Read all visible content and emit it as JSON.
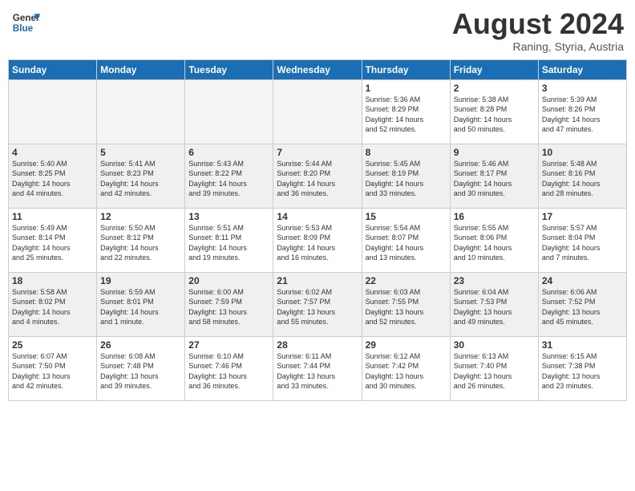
{
  "header": {
    "logo_line1": "General",
    "logo_line2": "Blue",
    "month": "August 2024",
    "location": "Raning, Styria, Austria"
  },
  "weekdays": [
    "Sunday",
    "Monday",
    "Tuesday",
    "Wednesday",
    "Thursday",
    "Friday",
    "Saturday"
  ],
  "weeks": [
    [
      {
        "day": "",
        "info": ""
      },
      {
        "day": "",
        "info": ""
      },
      {
        "day": "",
        "info": ""
      },
      {
        "day": "",
        "info": ""
      },
      {
        "day": "1",
        "info": "Sunrise: 5:36 AM\nSunset: 8:29 PM\nDaylight: 14 hours\nand 52 minutes."
      },
      {
        "day": "2",
        "info": "Sunrise: 5:38 AM\nSunset: 8:28 PM\nDaylight: 14 hours\nand 50 minutes."
      },
      {
        "day": "3",
        "info": "Sunrise: 5:39 AM\nSunset: 8:26 PM\nDaylight: 14 hours\nand 47 minutes."
      }
    ],
    [
      {
        "day": "4",
        "info": "Sunrise: 5:40 AM\nSunset: 8:25 PM\nDaylight: 14 hours\nand 44 minutes."
      },
      {
        "day": "5",
        "info": "Sunrise: 5:41 AM\nSunset: 8:23 PM\nDaylight: 14 hours\nand 42 minutes."
      },
      {
        "day": "6",
        "info": "Sunrise: 5:43 AM\nSunset: 8:22 PM\nDaylight: 14 hours\nand 39 minutes."
      },
      {
        "day": "7",
        "info": "Sunrise: 5:44 AM\nSunset: 8:20 PM\nDaylight: 14 hours\nand 36 minutes."
      },
      {
        "day": "8",
        "info": "Sunrise: 5:45 AM\nSunset: 8:19 PM\nDaylight: 14 hours\nand 33 minutes."
      },
      {
        "day": "9",
        "info": "Sunrise: 5:46 AM\nSunset: 8:17 PM\nDaylight: 14 hours\nand 30 minutes."
      },
      {
        "day": "10",
        "info": "Sunrise: 5:48 AM\nSunset: 8:16 PM\nDaylight: 14 hours\nand 28 minutes."
      }
    ],
    [
      {
        "day": "11",
        "info": "Sunrise: 5:49 AM\nSunset: 8:14 PM\nDaylight: 14 hours\nand 25 minutes."
      },
      {
        "day": "12",
        "info": "Sunrise: 5:50 AM\nSunset: 8:12 PM\nDaylight: 14 hours\nand 22 minutes."
      },
      {
        "day": "13",
        "info": "Sunrise: 5:51 AM\nSunset: 8:11 PM\nDaylight: 14 hours\nand 19 minutes."
      },
      {
        "day": "14",
        "info": "Sunrise: 5:53 AM\nSunset: 8:09 PM\nDaylight: 14 hours\nand 16 minutes."
      },
      {
        "day": "15",
        "info": "Sunrise: 5:54 AM\nSunset: 8:07 PM\nDaylight: 14 hours\nand 13 minutes."
      },
      {
        "day": "16",
        "info": "Sunrise: 5:55 AM\nSunset: 8:06 PM\nDaylight: 14 hours\nand 10 minutes."
      },
      {
        "day": "17",
        "info": "Sunrise: 5:57 AM\nSunset: 8:04 PM\nDaylight: 14 hours\nand 7 minutes."
      }
    ],
    [
      {
        "day": "18",
        "info": "Sunrise: 5:58 AM\nSunset: 8:02 PM\nDaylight: 14 hours\nand 4 minutes."
      },
      {
        "day": "19",
        "info": "Sunrise: 5:59 AM\nSunset: 8:01 PM\nDaylight: 14 hours\nand 1 minute."
      },
      {
        "day": "20",
        "info": "Sunrise: 6:00 AM\nSunset: 7:59 PM\nDaylight: 13 hours\nand 58 minutes."
      },
      {
        "day": "21",
        "info": "Sunrise: 6:02 AM\nSunset: 7:57 PM\nDaylight: 13 hours\nand 55 minutes."
      },
      {
        "day": "22",
        "info": "Sunrise: 6:03 AM\nSunset: 7:55 PM\nDaylight: 13 hours\nand 52 minutes."
      },
      {
        "day": "23",
        "info": "Sunrise: 6:04 AM\nSunset: 7:53 PM\nDaylight: 13 hours\nand 49 minutes."
      },
      {
        "day": "24",
        "info": "Sunrise: 6:06 AM\nSunset: 7:52 PM\nDaylight: 13 hours\nand 45 minutes."
      }
    ],
    [
      {
        "day": "25",
        "info": "Sunrise: 6:07 AM\nSunset: 7:50 PM\nDaylight: 13 hours\nand 42 minutes."
      },
      {
        "day": "26",
        "info": "Sunrise: 6:08 AM\nSunset: 7:48 PM\nDaylight: 13 hours\nand 39 minutes."
      },
      {
        "day": "27",
        "info": "Sunrise: 6:10 AM\nSunset: 7:46 PM\nDaylight: 13 hours\nand 36 minutes."
      },
      {
        "day": "28",
        "info": "Sunrise: 6:11 AM\nSunset: 7:44 PM\nDaylight: 13 hours\nand 33 minutes."
      },
      {
        "day": "29",
        "info": "Sunrise: 6:12 AM\nSunset: 7:42 PM\nDaylight: 13 hours\nand 30 minutes."
      },
      {
        "day": "30",
        "info": "Sunrise: 6:13 AM\nSunset: 7:40 PM\nDaylight: 13 hours\nand 26 minutes."
      },
      {
        "day": "31",
        "info": "Sunrise: 6:15 AM\nSunset: 7:38 PM\nDaylight: 13 hours\nand 23 minutes."
      }
    ]
  ]
}
